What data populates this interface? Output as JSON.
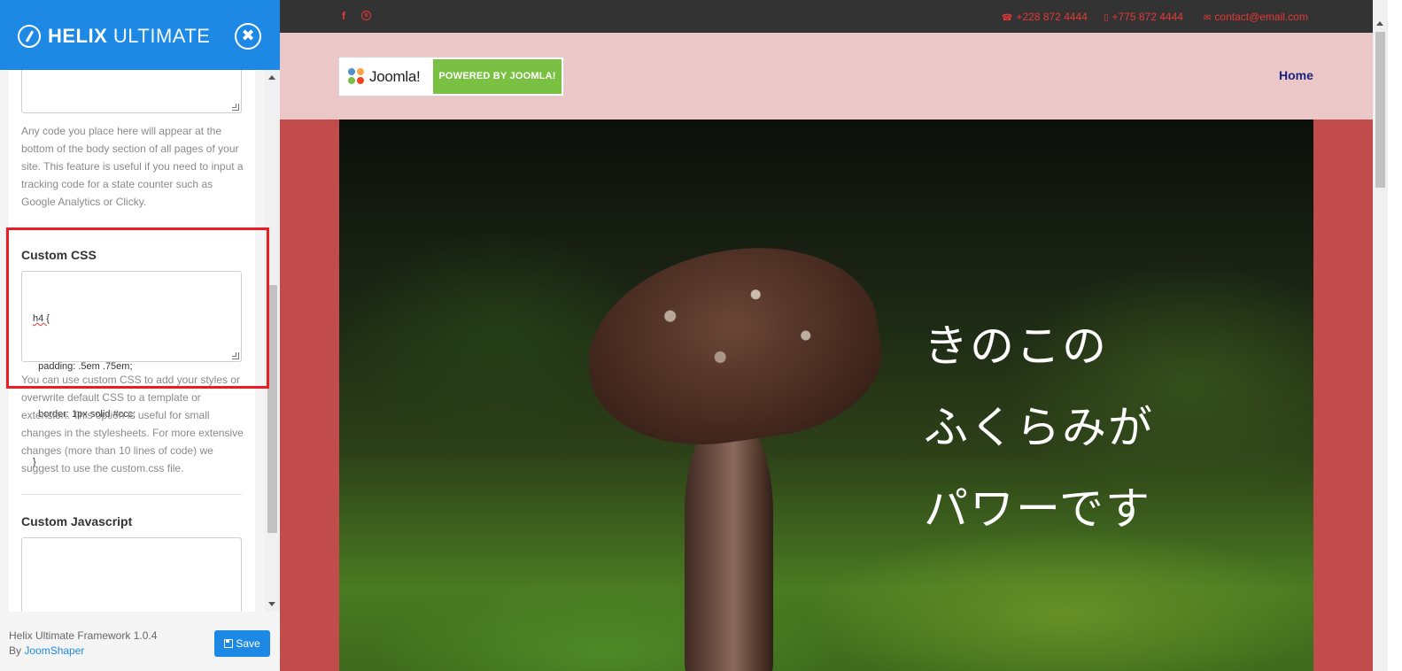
{
  "panel": {
    "brand_bold": "HELIX",
    "brand_light": "ULTIMATE",
    "close_icon": "close-icon",
    "custom_code_help": "Any code you place here will appear at the bottom of the body section of all pages of your site. This feature is useful if you need to input a tracking code for a state counter such as Google Analytics or Clicky.",
    "custom_css_label": "Custom CSS",
    "custom_css_code": [
      "h4 {",
      "  padding: .5em .75em;",
      "  border: 1px solid #ccc;",
      "}"
    ],
    "custom_css_help": "You can use custom CSS to add your styles or overwrite default CSS to a template or extension. This option is useful for small changes in the stylesheets. For more extensive changes (more than 10 lines of code) we suggest to use the custom.css file.",
    "custom_js_label": "Custom Javascript",
    "footer_title": "Helix Ultimate Framework 1.0.4",
    "footer_by": "By",
    "footer_author": "JoomShaper",
    "save_label": "Save",
    "accent_color": "#1e88e5",
    "highlight_color": "#ec1c24"
  },
  "site": {
    "topbar": {
      "social": [
        "facebook-icon",
        "skype-icon"
      ],
      "phone1": "+228 872 4444",
      "phone2": "+775 872 4444",
      "email": "contact@email.com",
      "accent_color": "#e53935"
    },
    "header": {
      "logo_word": "Joomla!",
      "logo_badge": "POWERED BY JOOMLA!",
      "nav_home": "Home",
      "background": "#ebc8c7"
    },
    "hero": {
      "lines": [
        "きのこの",
        "ふくらみが",
        "パワーです"
      ],
      "frame_color": "#c24b4b"
    }
  }
}
